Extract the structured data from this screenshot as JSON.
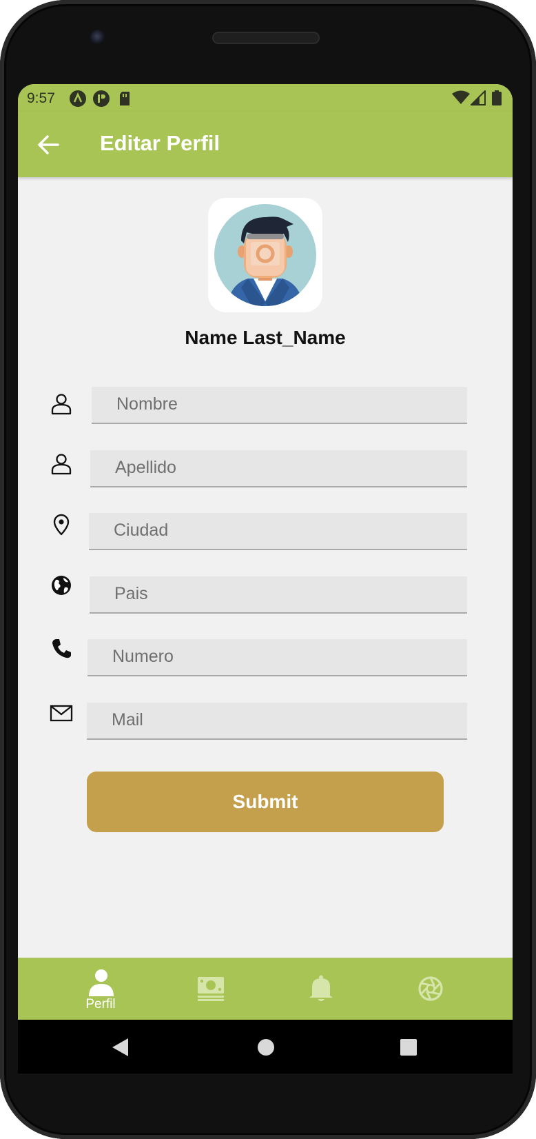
{
  "status_bar": {
    "time": "9:57"
  },
  "app_bar": {
    "title": "Editar Perfil",
    "back_icon": "arrow-left-icon"
  },
  "profile": {
    "name": "Name Last_Name",
    "avatar_icon": "user-avatar-illustration"
  },
  "form": {
    "fields": [
      {
        "icon": "person-outline-icon",
        "placeholder": "Nombre",
        "value": ""
      },
      {
        "icon": "person-outline-icon",
        "placeholder": "Apellido",
        "value": ""
      },
      {
        "icon": "location-pin-icon",
        "placeholder": "Ciudad",
        "value": ""
      },
      {
        "icon": "globe-icon",
        "placeholder": "Pais",
        "value": ""
      },
      {
        "icon": "phone-icon",
        "placeholder": "Numero",
        "value": ""
      },
      {
        "icon": "envelope-icon",
        "placeholder": "Mail",
        "value": ""
      }
    ],
    "submit_label": "Submit"
  },
  "bottom_nav": {
    "items": [
      {
        "icon": "person-icon",
        "label": "Perfil",
        "active": true
      },
      {
        "icon": "money-icon",
        "label": "",
        "active": false
      },
      {
        "icon": "bell-icon",
        "label": "",
        "active": false
      },
      {
        "icon": "aperture-icon",
        "label": "",
        "active": false
      }
    ]
  },
  "colors": {
    "accent": "#a8c454",
    "button": "#c4a04d",
    "background": "#f1f1f1",
    "field": "#e6e6e6",
    "nav_inactive": "#d6e5aa"
  }
}
